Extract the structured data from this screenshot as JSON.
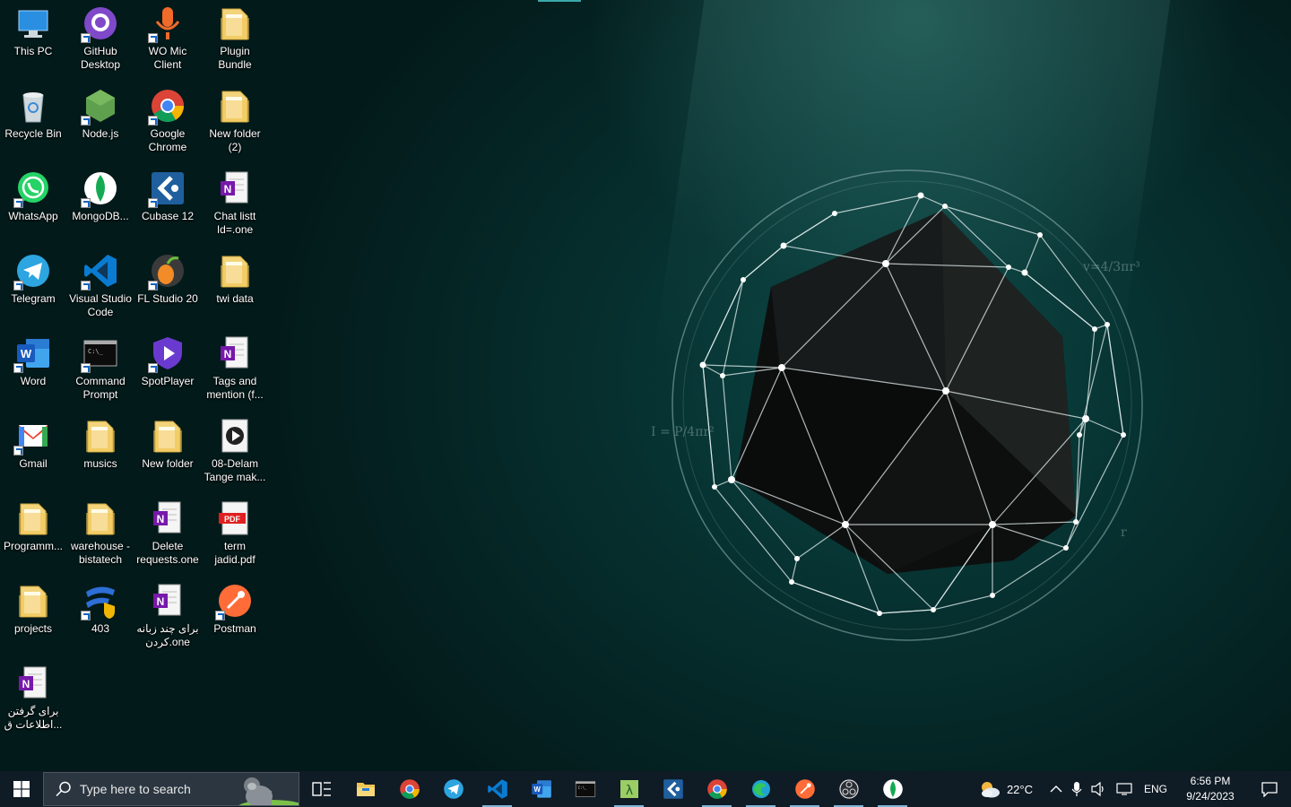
{
  "desktop": {
    "icons": [
      {
        "label": "This PC",
        "icon": "this-pc-icon"
      },
      {
        "label": "GitHub\nDesktop",
        "icon": "github-icon"
      },
      {
        "label": "WO Mic\nClient",
        "icon": "microphone-icon"
      },
      {
        "label": "Plugin\nBundle",
        "icon": "folder-icon"
      },
      {
        "label": "Recycle Bin",
        "icon": "recycle-bin-icon"
      },
      {
        "label": "Node.js",
        "icon": "nodejs-icon"
      },
      {
        "label": "Google\nChrome",
        "icon": "chrome-icon"
      },
      {
        "label": "New folder\n(2)",
        "icon": "folder-icon"
      },
      {
        "label": "WhatsApp",
        "icon": "whatsapp-icon"
      },
      {
        "label": "MongoDB...",
        "icon": "mongodb-icon"
      },
      {
        "label": "Cubase 12",
        "icon": "cubase-icon"
      },
      {
        "label": "Chat listt\nId=.one",
        "icon": "onenote-file-icon"
      },
      {
        "label": "Telegram",
        "icon": "telegram-icon"
      },
      {
        "label": "Visual Studio\nCode",
        "icon": "vscode-icon"
      },
      {
        "label": "FL Studio 20",
        "icon": "fl-studio-icon"
      },
      {
        "label": "twi data",
        "icon": "folder-icon"
      },
      {
        "label": "Word",
        "icon": "word-icon"
      },
      {
        "label": "Command\nPrompt",
        "icon": "command-prompt-icon"
      },
      {
        "label": "SpotPlayer",
        "icon": "spotplayer-icon"
      },
      {
        "label": "Tags and\nmention (f...",
        "icon": "onenote-file-icon"
      },
      {
        "label": "Gmail",
        "icon": "gmail-icon"
      },
      {
        "label": "musics",
        "icon": "folder-icon"
      },
      {
        "label": "New folder",
        "icon": "folder-icon"
      },
      {
        "label": "08-Delam\nTange mak...",
        "icon": "video-file-icon"
      },
      {
        "label": "Programm...",
        "icon": "folder-icon"
      },
      {
        "label": "warehouse -\nbistatech",
        "icon": "folder-icon"
      },
      {
        "label": "Delete\nrequests.one",
        "icon": "onenote-file-icon"
      },
      {
        "label": "term\njadid.pdf",
        "icon": "pdf-file-icon"
      },
      {
        "label": "projects",
        "icon": "folder-icon"
      },
      {
        "label": "403",
        "icon": "vpn-app-icon"
      },
      {
        "label": "برای چند زبانه\nکردن.one",
        "icon": "onenote-file-icon"
      },
      {
        "label": "Postman",
        "icon": "postman-icon"
      },
      {
        "label": "برای گرفتن\nاطلاعات ق...",
        "icon": "onenote-file-icon"
      }
    ],
    "formula_volume": "v=4/3πr³",
    "formula_intensity": "I = P/4πr²",
    "formula_radius": "r"
  },
  "taskbar": {
    "search_placeholder": "Type here to search",
    "pinned": [
      {
        "name": "task-view",
        "icon": "task-view-icon"
      },
      {
        "name": "file-explorer",
        "icon": "file-explorer-icon"
      },
      {
        "name": "chrome",
        "icon": "chrome-icon"
      },
      {
        "name": "telegram",
        "icon": "telegram-icon"
      },
      {
        "name": "vscode",
        "icon": "vscode-icon"
      },
      {
        "name": "word",
        "icon": "word-icon"
      },
      {
        "name": "command-prompt",
        "icon": "command-prompt-icon"
      },
      {
        "name": "lambda-app",
        "icon": "lambda-app-icon"
      },
      {
        "name": "cubase",
        "icon": "cubase-icon"
      },
      {
        "name": "chrome-profile",
        "icon": "chrome-icon"
      },
      {
        "name": "edge",
        "icon": "edge-icon"
      },
      {
        "name": "postman",
        "icon": "postman-icon"
      },
      {
        "name": "obs",
        "icon": "obs-icon"
      },
      {
        "name": "mongodb",
        "icon": "mongodb-icon"
      }
    ],
    "weather_temp": "22°C",
    "language": "ENG",
    "time": "6:56 PM",
    "date": "9/24/2023"
  }
}
